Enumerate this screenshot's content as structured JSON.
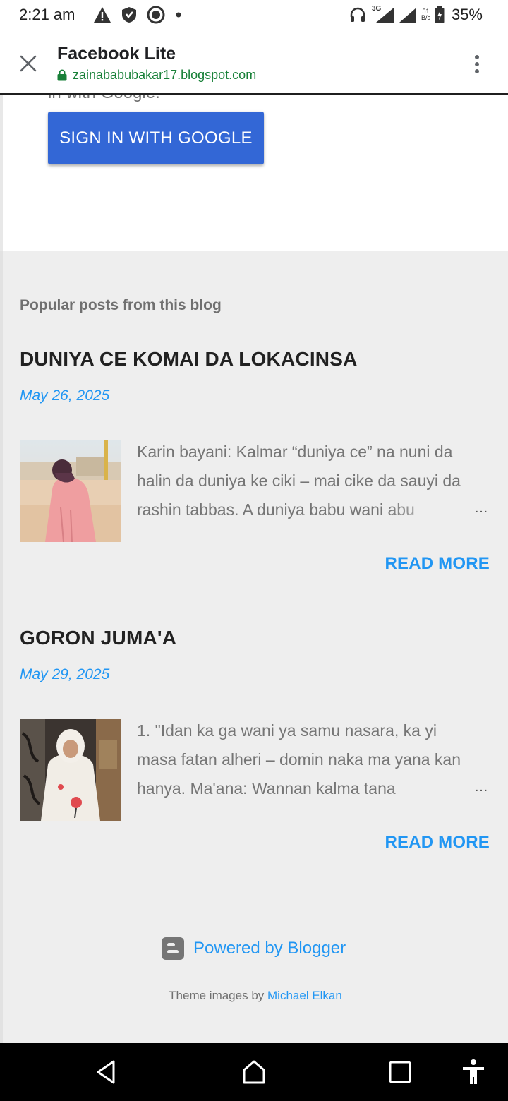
{
  "status_bar": {
    "time": "2:21 am",
    "net_speed_top": "51",
    "net_speed_bottom": "B/s",
    "network_type": "3G",
    "battery": "35%",
    "icons": [
      "warning-icon",
      "shield-icon",
      "whatsapp-icon",
      "dot-icon",
      "headphones-icon",
      "signal-icon",
      "signal-icon",
      "battery-charging-icon"
    ]
  },
  "toolbar": {
    "title": "Facebook Lite",
    "url": "zainababubakar17.blogspot.com",
    "close_icon": "close-icon",
    "menu_icon": "more-vert-icon",
    "lock_icon": "lock-icon"
  },
  "content": {
    "cut_text": "in with Google.",
    "google_button_label": "SIGN IN WITH GOOGLE"
  },
  "popular": {
    "heading": "Popular posts from this blog",
    "posts": [
      {
        "title": "DUNIYA CE KOMAI DA LOKACINSA",
        "date": "May 26, 2025",
        "snippet": "Karin bayani: Kalmar “duniya ce” na nuni da halin da duniya ke ciki – mai cike da sauyi da rashin tabbas. A duniya babu wani abu",
        "ellipsis": "…",
        "read_more": "READ MORE"
      },
      {
        "title": "GORON JUMA'A",
        "date": "May 29, 2025",
        "snippet": "1. \"Idan ka ga wani ya samu nasara, ka yi masa fatan alheri – domin naka ma yana kan hanya. Ma'ana: Wannan kalma tana",
        "ellipsis": "…",
        "read_more": "READ MORE"
      }
    ]
  },
  "footer": {
    "powered_by": "Powered by Blogger",
    "theme_prefix": "Theme images by",
    "theme_author": "Michael Elkan"
  },
  "colors": {
    "accent_blue": "#2196f3",
    "google_button": "#3367d6",
    "url_green": "#188038",
    "page_bg": "#eeeeee"
  }
}
